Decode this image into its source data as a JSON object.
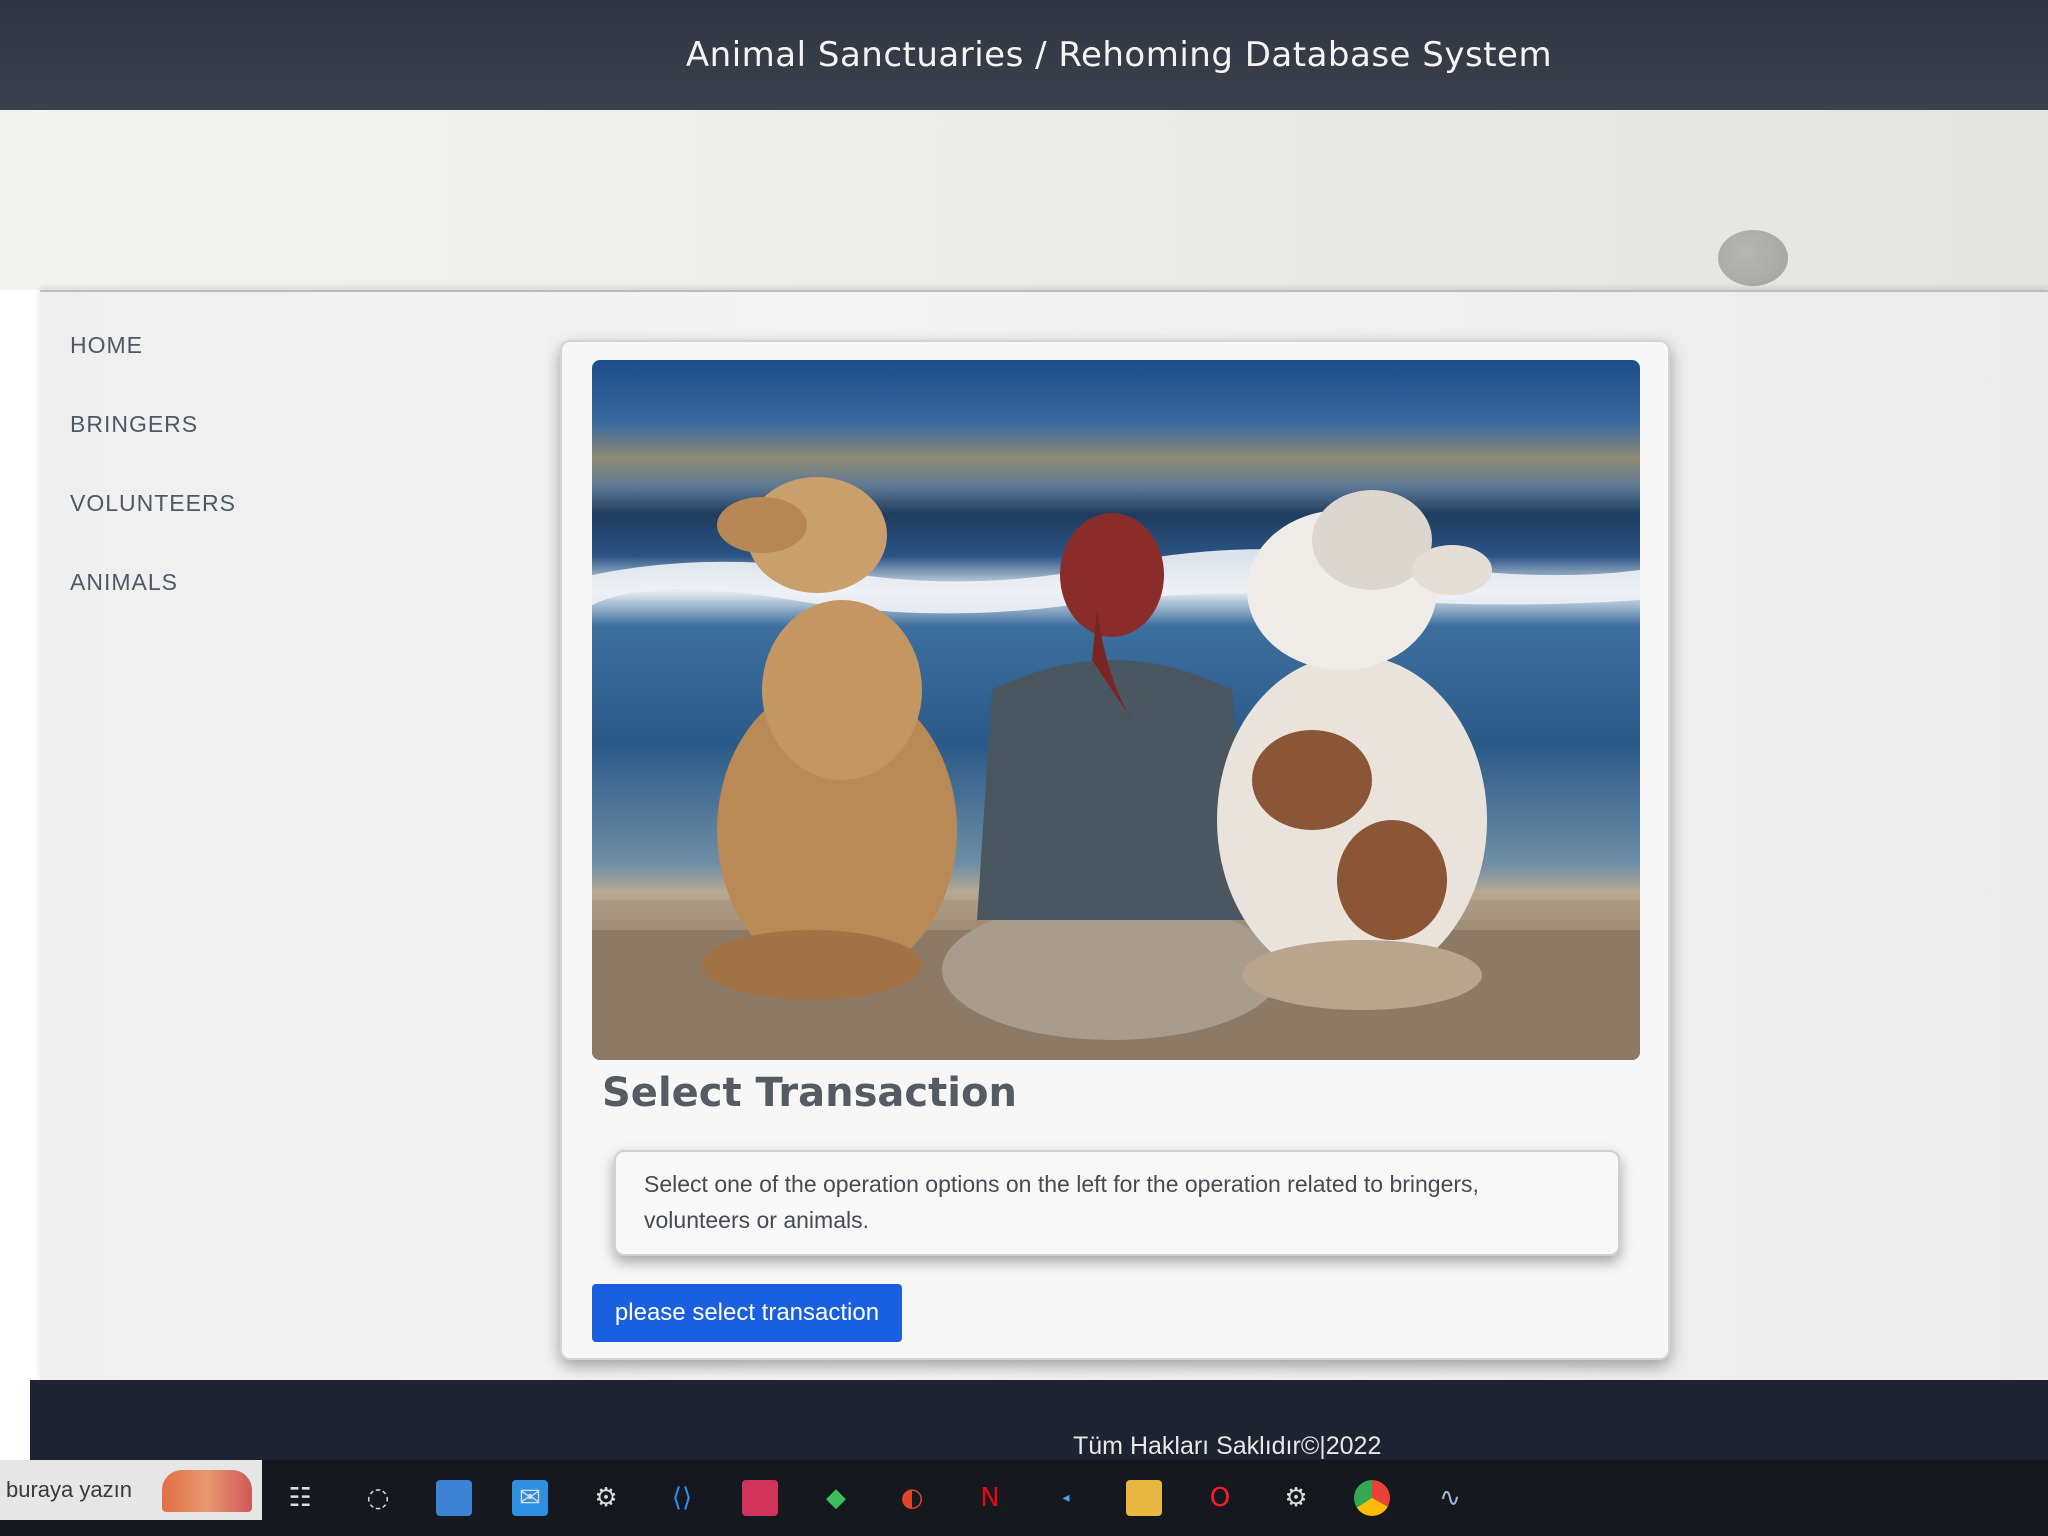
{
  "header": {
    "title": "Animal Sanctuaries / Rehoming Database System"
  },
  "sidebar": {
    "items": [
      {
        "label": "HOME"
      },
      {
        "label": "BRINGERS"
      },
      {
        "label": "VOLUNTEERS"
      },
      {
        "label": "ANIMALS"
      }
    ]
  },
  "main": {
    "title": "Select Transaction",
    "description": "Select one of the operation options on the left for the operation related to bringers, volunteers or animals.",
    "button_label": "please select transaction"
  },
  "footer": {
    "text": "Tüm Hakları Saklıdır©|2022"
  },
  "taskbar": {
    "search_placeholder": "buraya yazın",
    "icons": [
      "task-view-icon",
      "cortana-icon",
      "store-icon",
      "mail-icon",
      "steam-icon",
      "vscode-icon",
      "intellij-icon",
      "security-icon",
      "app-icon",
      "netflix-icon",
      "small-app-icon",
      "file-explorer-icon",
      "opera-icon",
      "settings-icon",
      "chrome-icon",
      "dolphin-icon"
    ]
  },
  "colors": {
    "header_bg": "#2f3642",
    "button_bg": "#1a5fe0",
    "footer_bg": "#1d2330",
    "sidebar_text": "#4d5866"
  }
}
